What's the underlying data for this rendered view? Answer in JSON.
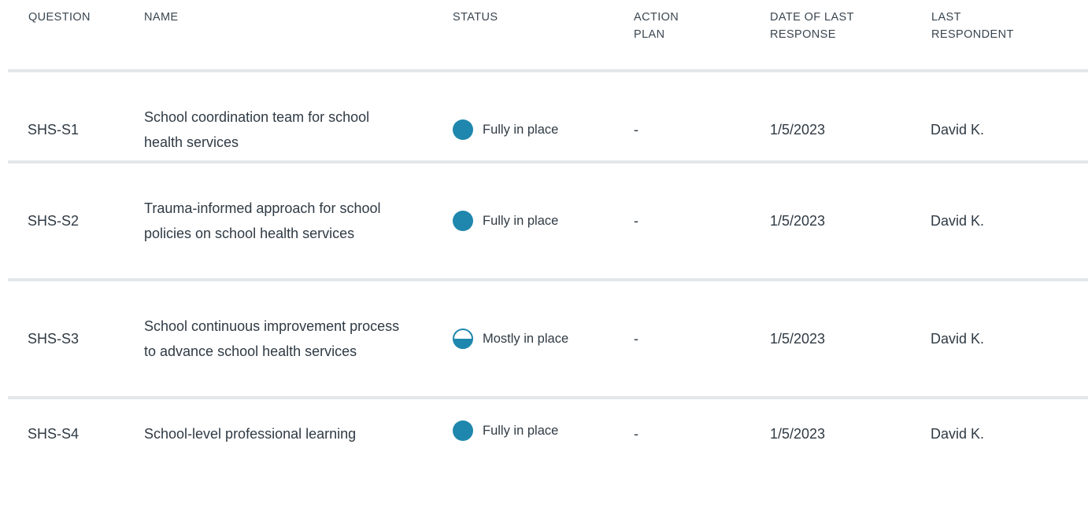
{
  "headers": {
    "question": "QUESTION",
    "name": "NAME",
    "status": "STATUS",
    "action_plan": "ACTION\nPLAN",
    "date": "DATE OF LAST\nRESPONSE",
    "respondent": "LAST\nRESPONDENT"
  },
  "rows": [
    {
      "question": "SHS-S1",
      "name": "School coordination team for school health services",
      "status": "Fully in place",
      "status_icon": "full-circle",
      "action_plan": "-",
      "date": "1/5/2023",
      "respondent": "David K."
    },
    {
      "question": "SHS-S2",
      "name": "Trauma-informed approach for school policies on school health services",
      "status": "Fully in place",
      "status_icon": "full-circle",
      "action_plan": "-",
      "date": "1/5/2023",
      "respondent": "David K."
    },
    {
      "question": "SHS-S3",
      "name": "School continuous improvement process to advance school health services",
      "status": "Mostly in place",
      "status_icon": "half-circle",
      "action_plan": "-",
      "date": "1/5/2023",
      "respondent": "David K."
    },
    {
      "question": "SHS-S4",
      "name": "School-level professional learning",
      "status": "Fully in place",
      "status_icon": "full-circle",
      "action_plan": "-",
      "date": "1/5/2023",
      "respondent": "David K."
    }
  ],
  "colors": {
    "status_accent": "#1f87ad",
    "divider": "#e4e7ea"
  }
}
